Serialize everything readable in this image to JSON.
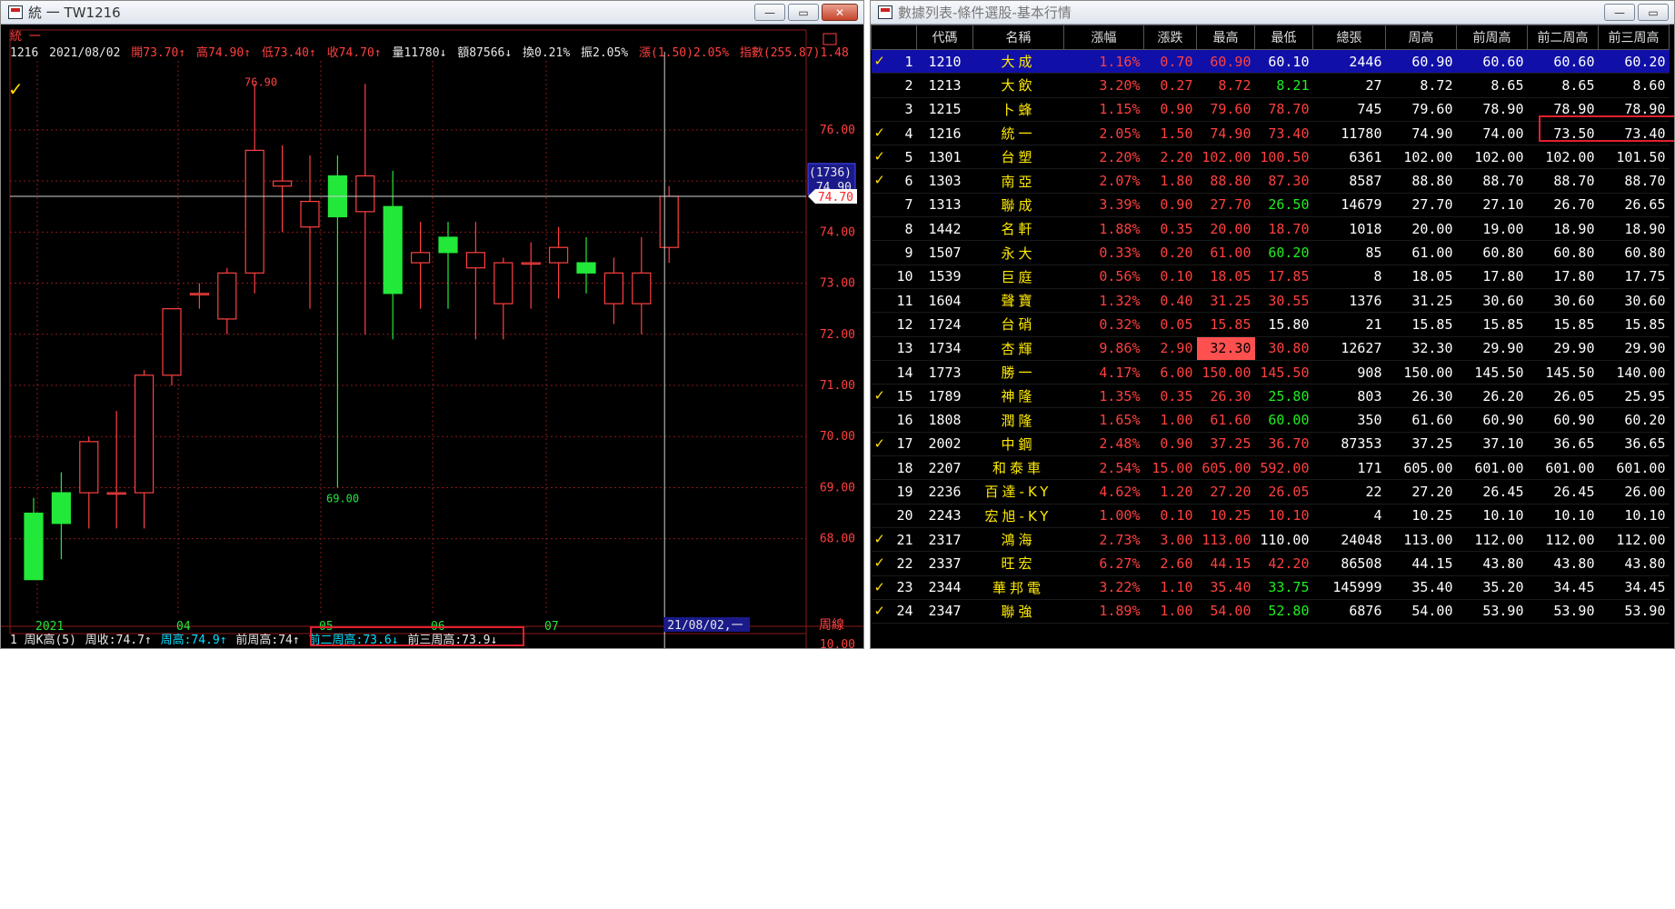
{
  "chart_window": {
    "title": "統 一 TW1216",
    "symbol_name": "統 一",
    "stock_code": "1216",
    "date": "2021/08/02",
    "quote": {
      "open": "開73.70↑",
      "high": "高74.90↑",
      "low": "低73.40↑",
      "close": "收74.70↑",
      "volume": "量11780↓",
      "amount": "額87566↓",
      "turnover": "換0.21%",
      "amplitude": "振2.05%",
      "change": "漲(1.50)2.05%",
      "index": "指數(255.87)1.48"
    },
    "price_labels": [
      "76.00",
      "75.00",
      "74.00",
      "73.00",
      "72.00",
      "71.00",
      "70.00",
      "69.00",
      "68.00"
    ],
    "current_price_box": "74.90",
    "current_price_count": "(1736)",
    "last_price_tag": "74.70",
    "max_label": "76.90",
    "min_label": "69.00",
    "x_labels": [
      "2021",
      "04",
      "05",
      "06",
      "07"
    ],
    "cursor_date": "21/08/02,一",
    "period_label": "周線",
    "bottom_axis_value": "10.00",
    "indicator_line": {
      "prefix": "1 周K高(5)",
      "week_close": "周收:74.7↑",
      "week_high": "周高:74.9↑",
      "prev_week_high": "前周高:74↑",
      "prev2_week_high": "前二周高:73.6↓",
      "prev3_week_high": "前三周高:73.9↓"
    },
    "colors": {
      "up": "#ff4040",
      "down": "#22e83a",
      "grid": "#8b1a1a"
    }
  },
  "chart_data": {
    "type": "candlestick",
    "title": "",
    "candles": [
      {
        "o": 68.5,
        "h": 68.8,
        "l": 67.2,
        "c": 67.2
      },
      {
        "o": 68.9,
        "h": 69.3,
        "l": 67.6,
        "c": 68.3
      },
      {
        "o": 68.9,
        "h": 70.0,
        "l": 68.2,
        "c": 69.9
      },
      {
        "o": 68.9,
        "h": 70.5,
        "l": 68.2,
        "c": 68.9
      },
      {
        "o": 68.9,
        "h": 71.3,
        "l": 68.2,
        "c": 71.2
      },
      {
        "o": 71.2,
        "h": 72.5,
        "l": 71.0,
        "c": 72.5
      },
      {
        "o": 72.8,
        "h": 73.0,
        "l": 72.5,
        "c": 72.8
      },
      {
        "o": 72.3,
        "h": 73.3,
        "l": 72.0,
        "c": 73.2
      },
      {
        "o": 73.2,
        "h": 76.9,
        "l": 72.8,
        "c": 75.6
      },
      {
        "o": 74.9,
        "h": 75.7,
        "l": 74.0,
        "c": 75.0
      },
      {
        "o": 74.1,
        "h": 75.5,
        "l": 72.5,
        "c": 74.6
      },
      {
        "o": 75.1,
        "h": 75.5,
        "l": 69.0,
        "c": 74.3
      },
      {
        "o": 74.4,
        "h": 76.9,
        "l": 72.0,
        "c": 75.1
      },
      {
        "o": 74.5,
        "h": 75.2,
        "l": 71.9,
        "c": 72.8
      },
      {
        "o": 73.4,
        "h": 74.2,
        "l": 72.5,
        "c": 73.6
      },
      {
        "o": 73.9,
        "h": 74.2,
        "l": 72.5,
        "c": 73.6
      },
      {
        "o": 73.3,
        "h": 74.2,
        "l": 71.9,
        "c": 73.6
      },
      {
        "o": 72.6,
        "h": 73.5,
        "l": 71.9,
        "c": 73.4
      },
      {
        "o": 73.4,
        "h": 73.8,
        "l": 72.5,
        "c": 73.4
      },
      {
        "o": 73.4,
        "h": 74.1,
        "l": 72.7,
        "c": 73.7
      },
      {
        "o": 73.4,
        "h": 73.9,
        "l": 72.8,
        "c": 73.2
      },
      {
        "o": 72.6,
        "h": 73.5,
        "l": 72.2,
        "c": 73.2
      },
      {
        "o": 72.6,
        "h": 73.9,
        "l": 72.0,
        "c": 73.2
      },
      {
        "o": 73.7,
        "h": 74.9,
        "l": 73.4,
        "c": 74.7
      }
    ],
    "ylim": [
      67.0,
      77.0
    ]
  },
  "table_window": {
    "title": "數據列表-條件選股-基本行情",
    "columns": [
      "",
      "代碼",
      "名稱",
      "漲幅",
      "漲跌",
      "最高",
      "最低",
      "總張",
      "周高",
      "前周高",
      "前二周高",
      "前三周高"
    ],
    "rows": [
      {
        "idx": "1",
        "check": true,
        "code": "1210",
        "name": "大成",
        "pct": "1.16%",
        "chg": "0.70",
        "hi": "60.90",
        "lo": "60.10",
        "lo_color": "white",
        "vol": "2446",
        "wh": "60.90",
        "pwh": "60.60",
        "p2wh": "60.60",
        "p3wh": "60.20"
      },
      {
        "idx": "2",
        "check": false,
        "code": "1213",
        "name": "大飲",
        "pct": "3.20%",
        "chg": "0.27",
        "hi": "8.72",
        "lo": "8.21",
        "lo_color": "green",
        "vol": "27",
        "wh": "8.72",
        "pwh": "8.65",
        "p2wh": "8.65",
        "p3wh": "8.60"
      },
      {
        "idx": "3",
        "check": false,
        "code": "1215",
        "name": "卜蜂",
        "pct": "1.15%",
        "chg": "0.90",
        "hi": "79.60",
        "lo": "78.70",
        "lo_color": "red",
        "vol": "745",
        "wh": "79.60",
        "pwh": "78.90",
        "p2wh": "78.90",
        "p3wh": "78.90"
      },
      {
        "idx": "4",
        "check": true,
        "code": "1216",
        "name": "統一",
        "pct": "2.05%",
        "chg": "1.50",
        "hi": "74.90",
        "lo": "73.40",
        "lo_color": "red",
        "vol": "11780",
        "wh": "74.90",
        "pwh": "74.00",
        "p2wh": "73.50",
        "p3wh": "73.40"
      },
      {
        "idx": "5",
        "check": true,
        "code": "1301",
        "name": "台塑",
        "pct": "2.20%",
        "chg": "2.20",
        "hi": "102.00",
        "lo": "100.50",
        "lo_color": "red",
        "vol": "6361",
        "wh": "102.00",
        "pwh": "102.00",
        "p2wh": "102.00",
        "p3wh": "101.50"
      },
      {
        "idx": "6",
        "check": true,
        "code": "1303",
        "name": "南亞",
        "pct": "2.07%",
        "chg": "1.80",
        "hi": "88.80",
        "lo": "87.30",
        "lo_color": "red",
        "vol": "8587",
        "wh": "88.80",
        "pwh": "88.70",
        "p2wh": "88.70",
        "p3wh": "88.70"
      },
      {
        "idx": "7",
        "check": false,
        "code": "1313",
        "name": "聯成",
        "pct": "3.39%",
        "chg": "0.90",
        "hi": "27.70",
        "lo": "26.50",
        "lo_color": "green",
        "vol": "14679",
        "wh": "27.70",
        "pwh": "27.10",
        "p2wh": "26.70",
        "p3wh": "26.65"
      },
      {
        "idx": "8",
        "check": false,
        "code": "1442",
        "name": "名軒",
        "pct": "1.88%",
        "chg": "0.35",
        "hi": "20.00",
        "lo": "18.70",
        "lo_color": "red",
        "vol": "1018",
        "wh": "20.00",
        "pwh": "19.00",
        "p2wh": "18.90",
        "p3wh": "18.90"
      },
      {
        "idx": "9",
        "check": false,
        "code": "1507",
        "name": "永大",
        "pct": "0.33%",
        "chg": "0.20",
        "hi": "61.00",
        "lo": "60.20",
        "lo_color": "green",
        "vol": "85",
        "wh": "61.00",
        "pwh": "60.80",
        "p2wh": "60.80",
        "p3wh": "60.80"
      },
      {
        "idx": "10",
        "check": false,
        "code": "1539",
        "name": "巨庭",
        "pct": "0.56%",
        "chg": "0.10",
        "hi": "18.05",
        "lo": "17.85",
        "lo_color": "red",
        "vol": "8",
        "wh": "18.05",
        "pwh": "17.80",
        "p2wh": "17.80",
        "p3wh": "17.75"
      },
      {
        "idx": "11",
        "check": false,
        "code": "1604",
        "name": "聲寶",
        "pct": "1.32%",
        "chg": "0.40",
        "hi": "31.25",
        "lo": "30.55",
        "lo_color": "red",
        "vol": "1376",
        "wh": "31.25",
        "pwh": "30.60",
        "p2wh": "30.60",
        "p3wh": "30.60"
      },
      {
        "idx": "12",
        "check": false,
        "code": "1724",
        "name": "台硝",
        "pct": "0.32%",
        "chg": "0.05",
        "hi": "15.85",
        "lo": "15.80",
        "lo_color": "white",
        "vol": "21",
        "wh": "15.85",
        "pwh": "15.85",
        "p2wh": "15.85",
        "p3wh": "15.85"
      },
      {
        "idx": "13",
        "check": false,
        "code": "1734",
        "name": "杏輝",
        "pct": "9.86%",
        "chg": "2.90",
        "hi": "32.30",
        "hi_box": true,
        "lo": "30.80",
        "lo_color": "red",
        "vol": "12627",
        "wh": "32.30",
        "pwh": "29.90",
        "p2wh": "29.90",
        "p3wh": "29.90"
      },
      {
        "idx": "14",
        "check": false,
        "code": "1773",
        "name": "勝一",
        "pct": "4.17%",
        "chg": "6.00",
        "hi": "150.00",
        "lo": "145.50",
        "lo_color": "red",
        "vol": "908",
        "wh": "150.00",
        "pwh": "145.50",
        "p2wh": "145.50",
        "p3wh": "140.00"
      },
      {
        "idx": "15",
        "check": true,
        "code": "1789",
        "name": "神隆",
        "pct": "1.35%",
        "chg": "0.35",
        "hi": "26.30",
        "lo": "25.80",
        "lo_color": "green",
        "vol": "803",
        "wh": "26.30",
        "pwh": "26.20",
        "p2wh": "26.05",
        "p3wh": "25.95"
      },
      {
        "idx": "16",
        "check": false,
        "code": "1808",
        "name": "潤隆",
        "pct": "1.65%",
        "chg": "1.00",
        "hi": "61.60",
        "lo": "60.00",
        "lo_color": "green",
        "vol": "350",
        "wh": "61.60",
        "pwh": "60.90",
        "p2wh": "60.90",
        "p3wh": "60.20"
      },
      {
        "idx": "17",
        "check": true,
        "code": "2002",
        "name": "中鋼",
        "pct": "2.48%",
        "chg": "0.90",
        "hi": "37.25",
        "lo": "36.70",
        "lo_color": "red",
        "vol": "87353",
        "wh": "37.25",
        "pwh": "37.10",
        "p2wh": "36.65",
        "p3wh": "36.65"
      },
      {
        "idx": "18",
        "check": false,
        "code": "2207",
        "name": "和泰車",
        "pct": "2.54%",
        "chg": "15.00",
        "hi": "605.00",
        "lo": "592.00",
        "lo_color": "red",
        "vol": "171",
        "wh": "605.00",
        "pwh": "601.00",
        "p2wh": "601.00",
        "p3wh": "601.00"
      },
      {
        "idx": "19",
        "check": false,
        "code": "2236",
        "name": "百達-KY",
        "pct": "4.62%",
        "chg": "1.20",
        "hi": "27.20",
        "lo": "26.05",
        "lo_color": "red",
        "vol": "22",
        "wh": "27.20",
        "pwh": "26.45",
        "p2wh": "26.45",
        "p3wh": "26.00"
      },
      {
        "idx": "20",
        "check": false,
        "code": "2243",
        "name": "宏旭-KY",
        "pct": "1.00%",
        "chg": "0.10",
        "hi": "10.25",
        "lo": "10.10",
        "lo_color": "red",
        "vol": "4",
        "wh": "10.25",
        "pwh": "10.10",
        "p2wh": "10.10",
        "p3wh": "10.10"
      },
      {
        "idx": "21",
        "check": true,
        "code": "2317",
        "name": "鴻海",
        "pct": "2.73%",
        "chg": "3.00",
        "hi": "113.00",
        "lo": "110.00",
        "lo_color": "white",
        "vol": "24048",
        "wh": "113.00",
        "pwh": "112.00",
        "p2wh": "112.00",
        "p3wh": "112.00"
      },
      {
        "idx": "22",
        "check": true,
        "code": "2337",
        "name": "旺宏",
        "pct": "6.27%",
        "chg": "2.60",
        "hi": "44.15",
        "lo": "42.20",
        "lo_color": "red",
        "vol": "86508",
        "wh": "44.15",
        "pwh": "43.80",
        "p2wh": "43.80",
        "p3wh": "43.80"
      },
      {
        "idx": "23",
        "check": true,
        "code": "2344",
        "name": "華邦電",
        "pct": "3.22%",
        "chg": "1.10",
        "hi": "35.40",
        "lo": "33.75",
        "lo_color": "green",
        "vol": "145999",
        "wh": "35.40",
        "pwh": "35.20",
        "p2wh": "34.45",
        "p3wh": "34.45"
      },
      {
        "idx": "24",
        "check": true,
        "code": "2347",
        "name": "聯強",
        "pct": "1.89%",
        "chg": "1.00",
        "hi": "54.00",
        "lo": "52.80",
        "lo_color": "green",
        "vol": "6876",
        "wh": "54.00",
        "pwh": "53.90",
        "p2wh": "53.90",
        "p3wh": "53.90"
      }
    ]
  }
}
